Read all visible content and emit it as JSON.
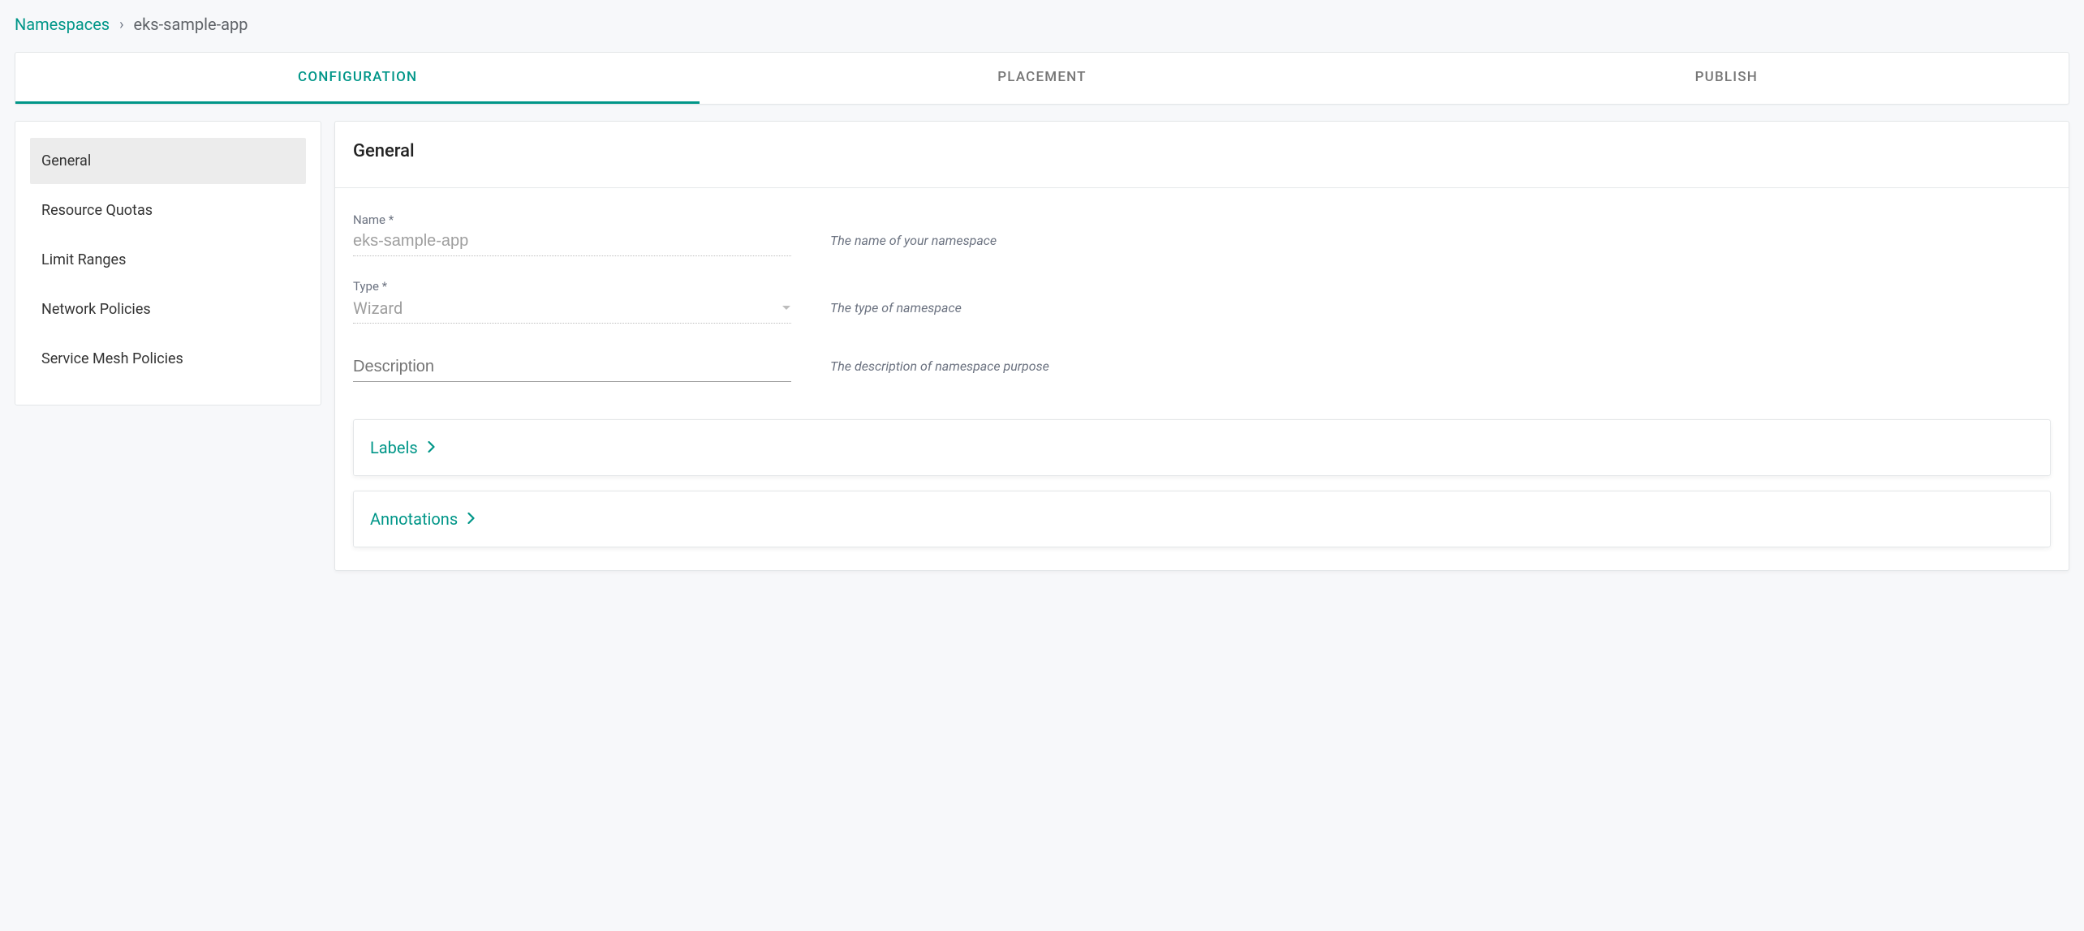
{
  "breadcrumb": {
    "parent": "Namespaces",
    "separator": "›",
    "current": "eks-sample-app"
  },
  "tabs": [
    {
      "label": "CONFIGURATION",
      "active": true
    },
    {
      "label": "PLACEMENT",
      "active": false
    },
    {
      "label": "PUBLISH",
      "active": false
    }
  ],
  "sidebar": {
    "items": [
      {
        "label": "General",
        "active": true
      },
      {
        "label": "Resource Quotas",
        "active": false
      },
      {
        "label": "Limit Ranges",
        "active": false
      },
      {
        "label": "Network Policies",
        "active": false
      },
      {
        "label": "Service Mesh Policies",
        "active": false
      }
    ]
  },
  "panel": {
    "title": "General",
    "form": {
      "name": {
        "label": "Name *",
        "value": "eks-sample-app",
        "help": "The name of your namespace"
      },
      "type": {
        "label": "Type *",
        "value": "Wizard",
        "help": "The type of namespace"
      },
      "description": {
        "placeholder": "Description",
        "value": "",
        "help": "The description of namespace purpose"
      }
    },
    "cards": {
      "labels": "Labels",
      "annotations": "Annotations"
    }
  }
}
